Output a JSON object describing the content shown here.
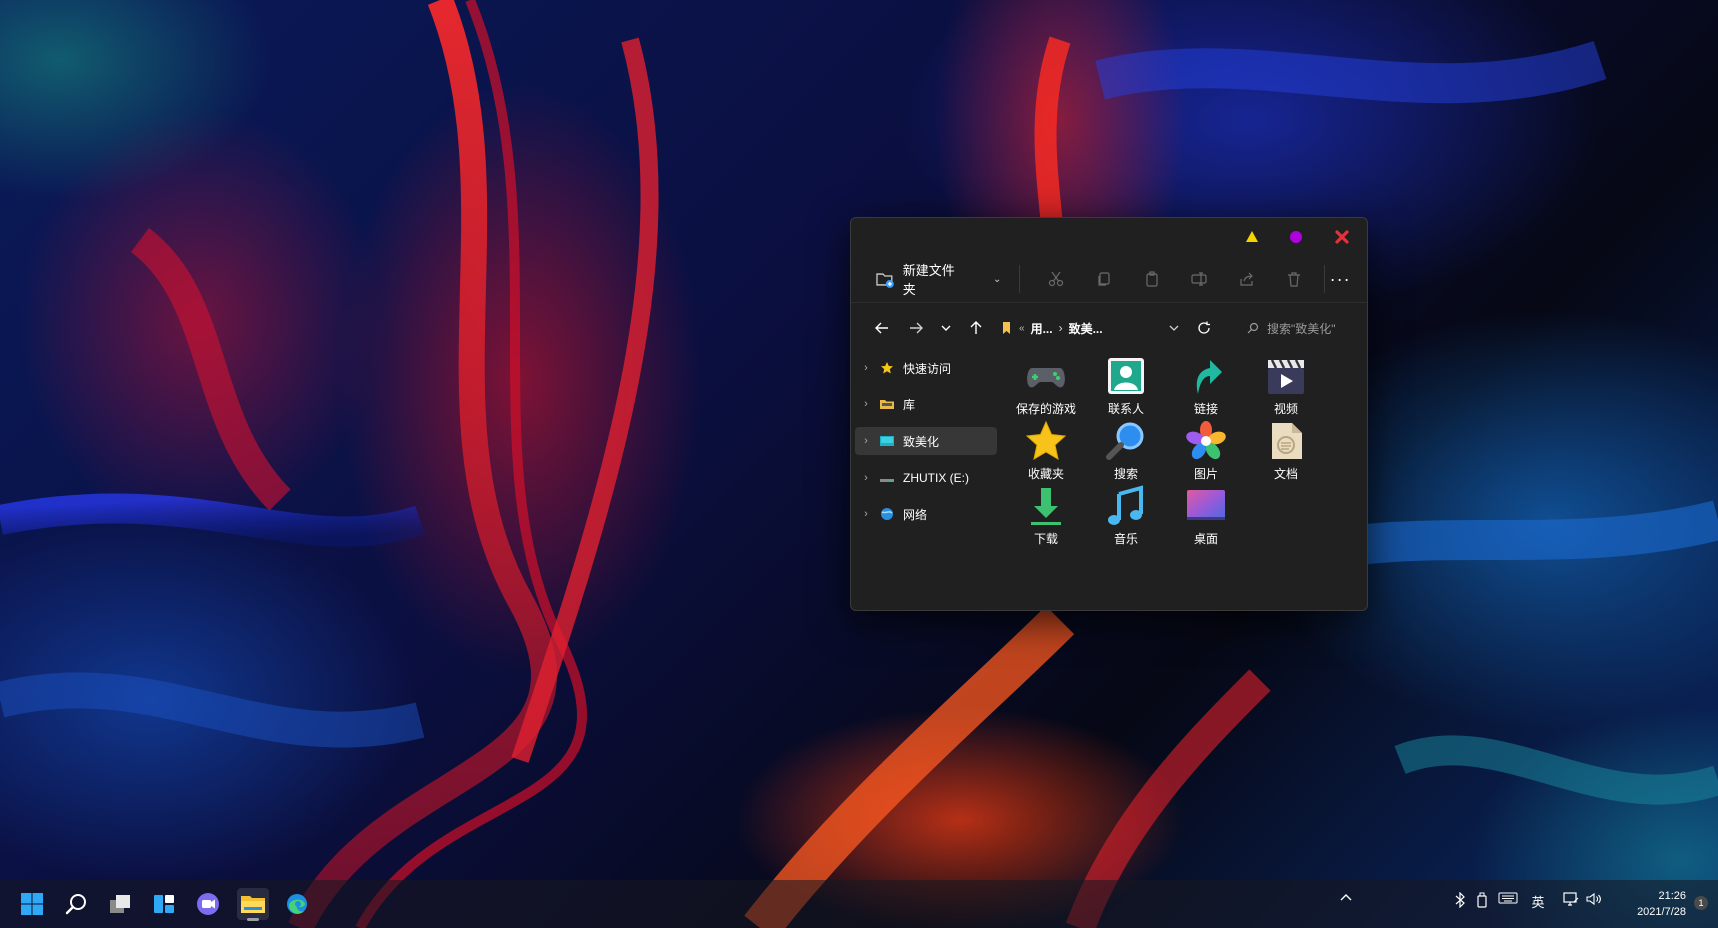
{
  "explorer": {
    "toolbar": {
      "new_folder_label": "新建文件夹",
      "more_label": "···"
    },
    "address": {
      "overflow": "«",
      "crumbs": [
        "用...",
        "致美..."
      ],
      "separator": "›",
      "search_placeholder": "搜索\"致美化\""
    },
    "nav_pane": [
      {
        "label": "快速访问",
        "icon": "star-icon"
      },
      {
        "label": "库",
        "icon": "library-folder-icon"
      },
      {
        "label": "致美化",
        "icon": "desktop-folder-icon",
        "selected": true
      },
      {
        "label": "ZHUTIX (E:)",
        "icon": "drive-icon"
      },
      {
        "label": "网络",
        "icon": "network-icon"
      }
    ],
    "items": [
      {
        "label": "保存的游戏",
        "icon": "gamepad-icon"
      },
      {
        "label": "联系人",
        "icon": "contacts-icon"
      },
      {
        "label": "链接",
        "icon": "link-arrow-icon"
      },
      {
        "label": "视频",
        "icon": "video-clapper-icon"
      },
      {
        "label": "收藏夹",
        "icon": "favorites-star-icon"
      },
      {
        "label": "搜索",
        "icon": "search-magnifier-icon"
      },
      {
        "label": "图片",
        "icon": "pictures-icon"
      },
      {
        "label": "文档",
        "icon": "documents-icon"
      },
      {
        "label": "下载",
        "icon": "download-icon"
      },
      {
        "label": "音乐",
        "icon": "music-note-icon"
      },
      {
        "label": "桌面",
        "icon": "desktop-icon"
      }
    ],
    "title_controls": {
      "minimize_color": "#f5d400",
      "maximize_color": "#b000e0",
      "close_color": "#e8303a"
    }
  },
  "taskbar": {
    "ime_label": "英",
    "time": "21:26",
    "date": "2021/7/28",
    "notification_count": "1"
  }
}
